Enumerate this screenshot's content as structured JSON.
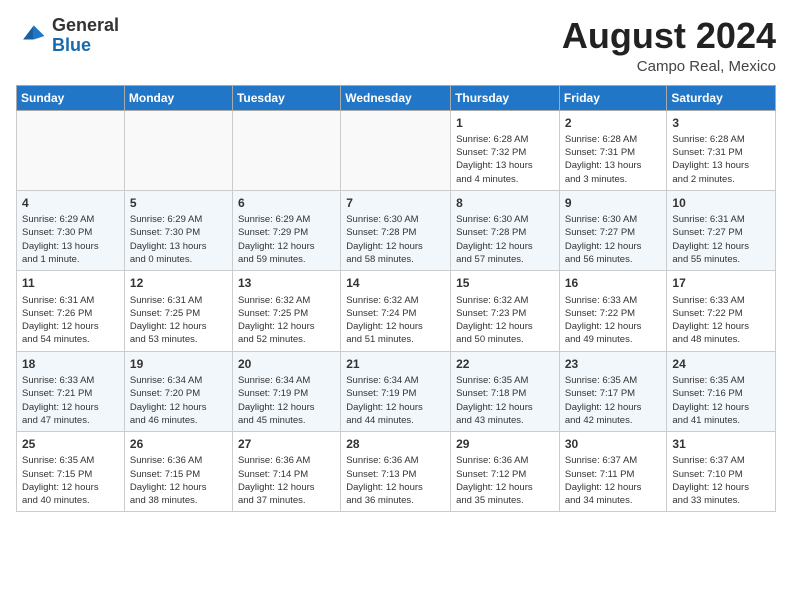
{
  "header": {
    "logo_general": "General",
    "logo_blue": "Blue",
    "month_year": "August 2024",
    "location": "Campo Real, Mexico"
  },
  "days_of_week": [
    "Sunday",
    "Monday",
    "Tuesday",
    "Wednesday",
    "Thursday",
    "Friday",
    "Saturday"
  ],
  "weeks": [
    [
      {
        "day": "",
        "info": ""
      },
      {
        "day": "",
        "info": ""
      },
      {
        "day": "",
        "info": ""
      },
      {
        "day": "",
        "info": ""
      },
      {
        "day": "1",
        "info": "Sunrise: 6:28 AM\nSunset: 7:32 PM\nDaylight: 13 hours\nand 4 minutes."
      },
      {
        "day": "2",
        "info": "Sunrise: 6:28 AM\nSunset: 7:31 PM\nDaylight: 13 hours\nand 3 minutes."
      },
      {
        "day": "3",
        "info": "Sunrise: 6:28 AM\nSunset: 7:31 PM\nDaylight: 13 hours\nand 2 minutes."
      }
    ],
    [
      {
        "day": "4",
        "info": "Sunrise: 6:29 AM\nSunset: 7:30 PM\nDaylight: 13 hours\nand 1 minute."
      },
      {
        "day": "5",
        "info": "Sunrise: 6:29 AM\nSunset: 7:30 PM\nDaylight: 13 hours\nand 0 minutes."
      },
      {
        "day": "6",
        "info": "Sunrise: 6:29 AM\nSunset: 7:29 PM\nDaylight: 12 hours\nand 59 minutes."
      },
      {
        "day": "7",
        "info": "Sunrise: 6:30 AM\nSunset: 7:28 PM\nDaylight: 12 hours\nand 58 minutes."
      },
      {
        "day": "8",
        "info": "Sunrise: 6:30 AM\nSunset: 7:28 PM\nDaylight: 12 hours\nand 57 minutes."
      },
      {
        "day": "9",
        "info": "Sunrise: 6:30 AM\nSunset: 7:27 PM\nDaylight: 12 hours\nand 56 minutes."
      },
      {
        "day": "10",
        "info": "Sunrise: 6:31 AM\nSunset: 7:27 PM\nDaylight: 12 hours\nand 55 minutes."
      }
    ],
    [
      {
        "day": "11",
        "info": "Sunrise: 6:31 AM\nSunset: 7:26 PM\nDaylight: 12 hours\nand 54 minutes."
      },
      {
        "day": "12",
        "info": "Sunrise: 6:31 AM\nSunset: 7:25 PM\nDaylight: 12 hours\nand 53 minutes."
      },
      {
        "day": "13",
        "info": "Sunrise: 6:32 AM\nSunset: 7:25 PM\nDaylight: 12 hours\nand 52 minutes."
      },
      {
        "day": "14",
        "info": "Sunrise: 6:32 AM\nSunset: 7:24 PM\nDaylight: 12 hours\nand 51 minutes."
      },
      {
        "day": "15",
        "info": "Sunrise: 6:32 AM\nSunset: 7:23 PM\nDaylight: 12 hours\nand 50 minutes."
      },
      {
        "day": "16",
        "info": "Sunrise: 6:33 AM\nSunset: 7:22 PM\nDaylight: 12 hours\nand 49 minutes."
      },
      {
        "day": "17",
        "info": "Sunrise: 6:33 AM\nSunset: 7:22 PM\nDaylight: 12 hours\nand 48 minutes."
      }
    ],
    [
      {
        "day": "18",
        "info": "Sunrise: 6:33 AM\nSunset: 7:21 PM\nDaylight: 12 hours\nand 47 minutes."
      },
      {
        "day": "19",
        "info": "Sunrise: 6:34 AM\nSunset: 7:20 PM\nDaylight: 12 hours\nand 46 minutes."
      },
      {
        "day": "20",
        "info": "Sunrise: 6:34 AM\nSunset: 7:19 PM\nDaylight: 12 hours\nand 45 minutes."
      },
      {
        "day": "21",
        "info": "Sunrise: 6:34 AM\nSunset: 7:19 PM\nDaylight: 12 hours\nand 44 minutes."
      },
      {
        "day": "22",
        "info": "Sunrise: 6:35 AM\nSunset: 7:18 PM\nDaylight: 12 hours\nand 43 minutes."
      },
      {
        "day": "23",
        "info": "Sunrise: 6:35 AM\nSunset: 7:17 PM\nDaylight: 12 hours\nand 42 minutes."
      },
      {
        "day": "24",
        "info": "Sunrise: 6:35 AM\nSunset: 7:16 PM\nDaylight: 12 hours\nand 41 minutes."
      }
    ],
    [
      {
        "day": "25",
        "info": "Sunrise: 6:35 AM\nSunset: 7:15 PM\nDaylight: 12 hours\nand 40 minutes."
      },
      {
        "day": "26",
        "info": "Sunrise: 6:36 AM\nSunset: 7:15 PM\nDaylight: 12 hours\nand 38 minutes."
      },
      {
        "day": "27",
        "info": "Sunrise: 6:36 AM\nSunset: 7:14 PM\nDaylight: 12 hours\nand 37 minutes."
      },
      {
        "day": "28",
        "info": "Sunrise: 6:36 AM\nSunset: 7:13 PM\nDaylight: 12 hours\nand 36 minutes."
      },
      {
        "day": "29",
        "info": "Sunrise: 6:36 AM\nSunset: 7:12 PM\nDaylight: 12 hours\nand 35 minutes."
      },
      {
        "day": "30",
        "info": "Sunrise: 6:37 AM\nSunset: 7:11 PM\nDaylight: 12 hours\nand 34 minutes."
      },
      {
        "day": "31",
        "info": "Sunrise: 6:37 AM\nSunset: 7:10 PM\nDaylight: 12 hours\nand 33 minutes."
      }
    ]
  ]
}
